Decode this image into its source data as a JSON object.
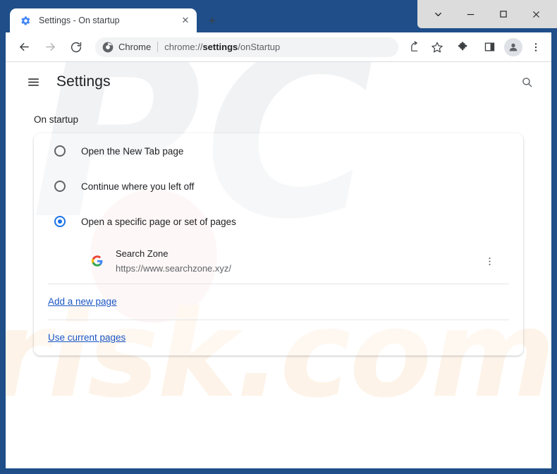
{
  "window": {
    "controls": [
      {
        "name": "tab-search",
        "glyph": "⌄"
      },
      {
        "name": "minimize",
        "glyph": "–"
      },
      {
        "name": "maximize",
        "glyph": "□"
      },
      {
        "name": "close",
        "glyph": "✕"
      }
    ]
  },
  "tab": {
    "title": "Settings - On startup",
    "favicon": "gear-icon",
    "close_glyph": "✕",
    "new_tab_glyph": "+"
  },
  "toolbar": {
    "back_glyph": "←",
    "forward_glyph": "→",
    "reload_glyph": "⟳",
    "omnibox": {
      "badge_icon": "chrome-logo-icon",
      "scheme_label": "Chrome",
      "url_prefix": "chrome://",
      "url_bold": "settings",
      "url_suffix": "/onStartup",
      "full_url": "chrome://settings/onStartup"
    },
    "actions": [
      {
        "name": "share-icon"
      },
      {
        "name": "bookmark-star-icon"
      },
      {
        "name": "extensions-puzzle-icon"
      },
      {
        "name": "side-panel-icon"
      }
    ],
    "avatar": "profile-avatar-icon",
    "menu_glyph": "⋮"
  },
  "settings": {
    "menu_icon": "hamburger-menu-icon",
    "title": "Settings",
    "search_icon": "search-icon",
    "section_title": "On startup",
    "radio_options": [
      {
        "label": "Open the New Tab page",
        "checked": false
      },
      {
        "label": "Continue where you left off",
        "checked": false
      },
      {
        "label": "Open a specific page or set of pages",
        "checked": true
      }
    ],
    "startup_page": {
      "favicon": "google-g-icon",
      "name": "Search Zone",
      "url": "https://www.searchzone.xyz/",
      "more_glyph": "⋮"
    },
    "add_page_link": "Add a new page",
    "use_current_link": "Use current pages"
  },
  "watermark": {
    "top_text": "PC",
    "bottom_text": "risk.com"
  },
  "colors": {
    "accent_blue": "#1a73e8",
    "link_blue": "#1a56c4",
    "frame_blue": "#1f4e89",
    "text_primary": "#202124",
    "text_secondary": "#5f6368"
  }
}
